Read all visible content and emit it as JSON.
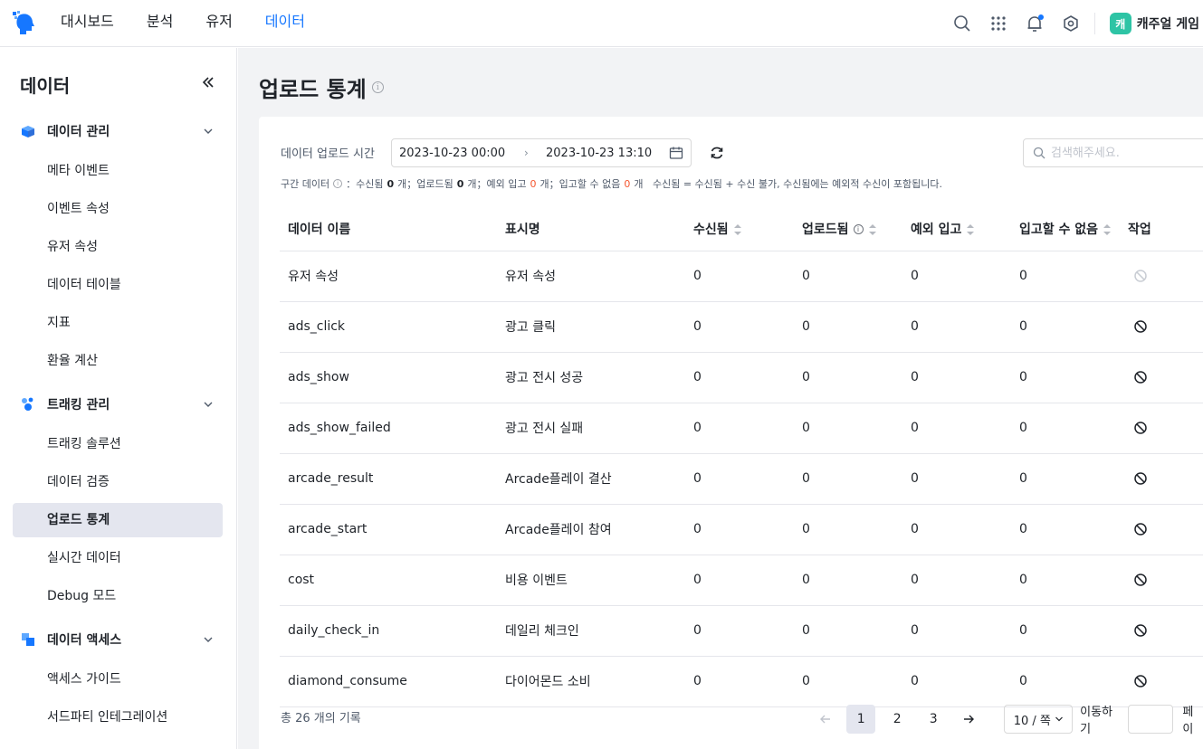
{
  "header": {
    "nav": [
      {
        "label": "대시보드",
        "active": false
      },
      {
        "label": "분석",
        "active": false
      },
      {
        "label": "유저",
        "active": false
      },
      {
        "label": "데이터",
        "active": true
      }
    ],
    "project_badge": "캐",
    "project_name": "캐주얼 게임"
  },
  "sidebar": {
    "title": "데이터",
    "groups": {
      "data_mgmt": {
        "label": "데이터 관리",
        "items": [
          "메타 이벤트",
          "이벤트 속성",
          "유저 속성",
          "데이터 테이블",
          "지표",
          "환율 계산"
        ]
      },
      "tracking_mgmt": {
        "label": "트래킹 관리",
        "items": [
          "트래킹 솔루션",
          "데이터 검증",
          "업로드 통계",
          "실시간 데이터",
          "Debug 모드"
        ]
      },
      "data_access": {
        "label": "데이터 액세스",
        "items": [
          "액세스 가이드",
          "서드파티 인테그레이션"
        ]
      }
    },
    "active_item": "업로드 통계"
  },
  "main": {
    "page_title": "업로드 통계",
    "filter": {
      "label": "데이터 업로드 시간",
      "start": "2023-10-23 00:00",
      "end": "2023-10-23 13:10",
      "search_placeholder": "검색해주세요."
    },
    "summary": {
      "label": "구간 데이터",
      "received_label": "：수신됨",
      "received": "0",
      "uploaded_label": "개；업로드됨",
      "uploaded": "0",
      "exception_label": "개；예외 입고",
      "exception": "0",
      "rejected_label": "개；입고할 수 없음",
      "rejected": "0",
      "tail": "개   수신됨 = 수신됨 + 수신 불가, 수신됨에는 예외적 수신이 포함됩니다."
    },
    "table": {
      "headers": {
        "name": "데이터 이름",
        "display": "표시명",
        "received": "수신됨",
        "uploaded": "업로드됨",
        "exception": "예외 입고",
        "rejected": "입고할 수 없음",
        "action": "작업"
      },
      "rows": [
        {
          "name": "유저 속성",
          "display": "유저 속성",
          "received": "0",
          "uploaded": "0",
          "exception": "0",
          "rejected": "0",
          "action_disabled": true
        },
        {
          "name": "ads_click",
          "display": "광고 클릭",
          "received": "0",
          "uploaded": "0",
          "exception": "0",
          "rejected": "0",
          "action_disabled": false
        },
        {
          "name": "ads_show",
          "display": "광고 전시 성공",
          "received": "0",
          "uploaded": "0",
          "exception": "0",
          "rejected": "0",
          "action_disabled": false
        },
        {
          "name": "ads_show_failed",
          "display": "광고 전시 실패",
          "received": "0",
          "uploaded": "0",
          "exception": "0",
          "rejected": "0",
          "action_disabled": false
        },
        {
          "name": "arcade_result",
          "display": "Arcade플레이 결산",
          "received": "0",
          "uploaded": "0",
          "exception": "0",
          "rejected": "0",
          "action_disabled": false
        },
        {
          "name": "arcade_start",
          "display": "Arcade플레이 참여",
          "received": "0",
          "uploaded": "0",
          "exception": "0",
          "rejected": "0",
          "action_disabled": false
        },
        {
          "name": "cost",
          "display": "비용 이벤트",
          "received": "0",
          "uploaded": "0",
          "exception": "0",
          "rejected": "0",
          "action_disabled": false
        },
        {
          "name": "daily_check_in",
          "display": "데일리 체크인",
          "received": "0",
          "uploaded": "0",
          "exception": "0",
          "rejected": "0",
          "action_disabled": false
        },
        {
          "name": "diamond_consume",
          "display": "다이어몬드 소비",
          "received": "0",
          "uploaded": "0",
          "exception": "0",
          "rejected": "0",
          "action_disabled": false
        }
      ]
    },
    "footer": {
      "total": "총 26 개의 기록",
      "pages": [
        "1",
        "2",
        "3"
      ],
      "current_page": "1",
      "page_size": "10 / 쪽",
      "jump_label": "이동하기",
      "jump_suffix": "페이"
    }
  },
  "colors": {
    "accent": "#1677ff",
    "warn": "#f5562f",
    "badge": "#2ec4a5",
    "active_bg": "#e4e6ef"
  }
}
